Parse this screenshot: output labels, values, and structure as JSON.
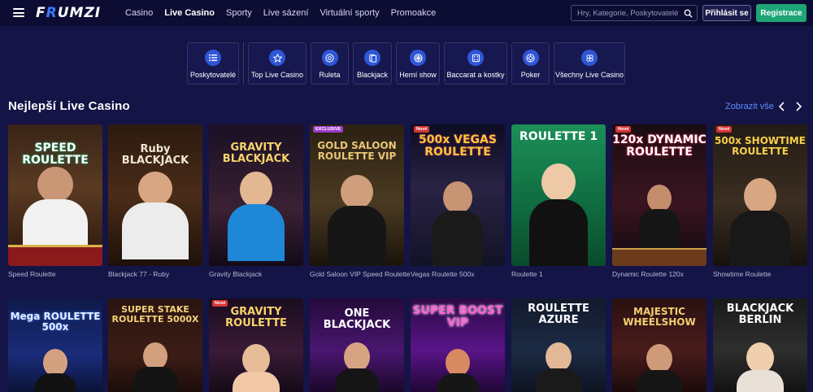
{
  "header": {
    "logo": "FRUMZI",
    "nav": [
      "Casino",
      "Live Casino",
      "Sporty",
      "Live sázení",
      "Virtuální sporty",
      "Promoakce"
    ],
    "active_nav": "Live Casino",
    "search_placeholder": "Hry, Kategorie, Poskytovatelé",
    "login_label": "Přihlásit se",
    "register_label": "Registrace"
  },
  "categories": [
    {
      "label": "Poskytovatelé",
      "icon": "list-icon"
    },
    {
      "label": "Top Live Casino",
      "icon": "star-icon"
    },
    {
      "label": "Ruleta",
      "icon": "roulette-icon"
    },
    {
      "label": "Blackjack",
      "icon": "cards-icon"
    },
    {
      "label": "Herní show",
      "icon": "wheel-icon"
    },
    {
      "label": "Baccarat a kostky",
      "icon": "dice-icon"
    },
    {
      "label": "Poker",
      "icon": "chip-icon"
    },
    {
      "label": "Všechny Live Casino",
      "icon": "all-icon"
    }
  ],
  "section": {
    "title": "Nejlepší Live Casino",
    "view_all": "Zobrazit vše"
  },
  "row1": [
    {
      "name": "Speed Roulette",
      "thumb_title": "SPEED ROULETTE",
      "badge": ""
    },
    {
      "name": "Blackjack 77 - Ruby",
      "thumb_title": "Ruby BLACKJACK",
      "badge": ""
    },
    {
      "name": "Gravity Blackjack",
      "thumb_title": "GRAVITY BLACKJACK",
      "badge": ""
    },
    {
      "name": "Gold Saloon VIP Speed Roulette",
      "thumb_title": "GOLD SALOON ROULETTE VIP",
      "badge": "EXCLUSIVE"
    },
    {
      "name": "Vegas Roulette 500x",
      "thumb_title": "500x VEGAS ROULETTE",
      "badge": "Nové"
    },
    {
      "name": "Roulette 1",
      "thumb_title": "ROULETTE 1",
      "badge": ""
    },
    {
      "name": "Dynamic Roulette 120x",
      "thumb_title": "120x DYNAMIC ROULETTE",
      "badge": "Nové"
    },
    {
      "name": "Showtime Roulette",
      "thumb_title": "500x SHOWTIME ROULETTE",
      "badge": "Nové"
    }
  ],
  "row2": [
    {
      "thumb_title": "Mega ROULETTE 500x",
      "badge": ""
    },
    {
      "thumb_title": "SUPER STAKE ROULETTE 5000X",
      "badge": ""
    },
    {
      "thumb_title": "GRAVITY ROULETTE",
      "badge": "Nové"
    },
    {
      "thumb_title": "ONE BLACKJACK",
      "badge": ""
    },
    {
      "thumb_title": "SUPER BOOST VIP",
      "badge": ""
    },
    {
      "thumb_title": "ROULETTE AZURE",
      "badge": ""
    },
    {
      "thumb_title": "MAJESTIC WHEELSHOW",
      "badge": ""
    },
    {
      "thumb_title": "BLACKJACK BERLIN",
      "badge": ""
    }
  ]
}
